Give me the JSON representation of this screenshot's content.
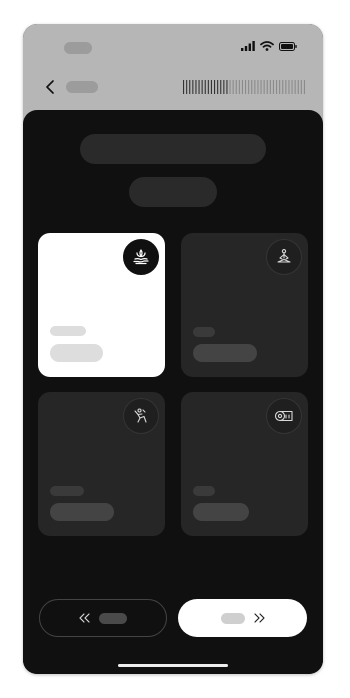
{
  "status_bar": {
    "icons": [
      "signal-icon",
      "wifi-icon",
      "battery-icon"
    ]
  },
  "header": {
    "back_icon": "chevron-left-icon"
  },
  "cards": [
    {
      "icon": "lotus-hand-icon",
      "selected": true
    },
    {
      "icon": "meditation-icon",
      "selected": false
    },
    {
      "icon": "stretch-icon",
      "selected": false
    },
    {
      "icon": "yoga-mat-icon",
      "selected": false
    }
  ],
  "navigation": {
    "prev_icon": "double-chevron-left-icon",
    "next_icon": "double-chevron-right-icon"
  },
  "colors": {
    "background": "#101010",
    "header": "#b6b6b6",
    "card": "#262626",
    "card_selected": "#ffffff"
  }
}
